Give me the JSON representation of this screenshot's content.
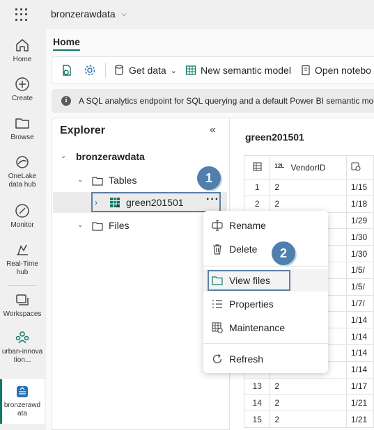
{
  "header": {
    "workspace_name": "bronzerawdata"
  },
  "leftnav": {
    "items": [
      {
        "label": "Home",
        "icon": "home-icon"
      },
      {
        "label": "Create",
        "icon": "plus-circle-icon"
      },
      {
        "label": "Browse",
        "icon": "folder-icon"
      },
      {
        "label": "OneLake data hub",
        "icon": "onelake-icon"
      },
      {
        "label": "Monitor",
        "icon": "monitor-icon"
      },
      {
        "label": "Real-Time hub",
        "icon": "realtime-icon"
      },
      {
        "label": "Workspaces",
        "icon": "workspaces-icon"
      },
      {
        "label": "urban-innovation...",
        "icon": "group-icon"
      },
      {
        "label": "bronzerawdata",
        "icon": "lakehouse-icon"
      }
    ]
  },
  "tabs": {
    "home": "Home"
  },
  "toolbar": {
    "get_data": "Get data",
    "new_semantic_model": "New semantic model",
    "open_notebook": "Open notebo"
  },
  "infobar": {
    "text": "A SQL analytics endpoint for SQL querying and a default Power BI semantic mod"
  },
  "explorer": {
    "title": "Explorer",
    "root": "bronzerawdata",
    "tables_label": "Tables",
    "table_name": "green201501",
    "files_label": "Files",
    "more_icon": "ellipsis-icon"
  },
  "grid": {
    "title": "green201501",
    "type_badge": "12L",
    "column_vendor": "VendorID",
    "rows": [
      {
        "n": "1",
        "vendor": "2",
        "date": "1/15"
      },
      {
        "n": "2",
        "vendor": "2",
        "date": "1/18"
      },
      {
        "n": "",
        "vendor": "",
        "date": "1/29"
      },
      {
        "n": "",
        "vendor": "",
        "date": "1/30"
      },
      {
        "n": "",
        "vendor": "",
        "date": "1/30"
      },
      {
        "n": "",
        "vendor": "",
        "date": "1/5/"
      },
      {
        "n": "",
        "vendor": "",
        "date": "1/5/"
      },
      {
        "n": "",
        "vendor": "",
        "date": "1/7/"
      },
      {
        "n": "",
        "vendor": "",
        "date": "1/14"
      },
      {
        "n": "",
        "vendor": "",
        "date": "1/14"
      },
      {
        "n": "",
        "vendor": "",
        "date": "1/14"
      },
      {
        "n": "",
        "vendor": "",
        "date": "1/14"
      },
      {
        "n": "13",
        "vendor": "2",
        "date": "1/17"
      },
      {
        "n": "14",
        "vendor": "2",
        "date": "1/21"
      },
      {
        "n": "15",
        "vendor": "2",
        "date": "1/21"
      }
    ]
  },
  "context_menu": {
    "rename": "Rename",
    "delete": "Delete",
    "view_files": "View files",
    "properties": "Properties",
    "maintenance": "Maintenance",
    "refresh": "Refresh"
  },
  "callouts": {
    "step1": "1",
    "step2": "2"
  },
  "colors": {
    "accent": "#117865",
    "callout": "#4e7fae",
    "highlight_border": "#5b7fa6"
  }
}
